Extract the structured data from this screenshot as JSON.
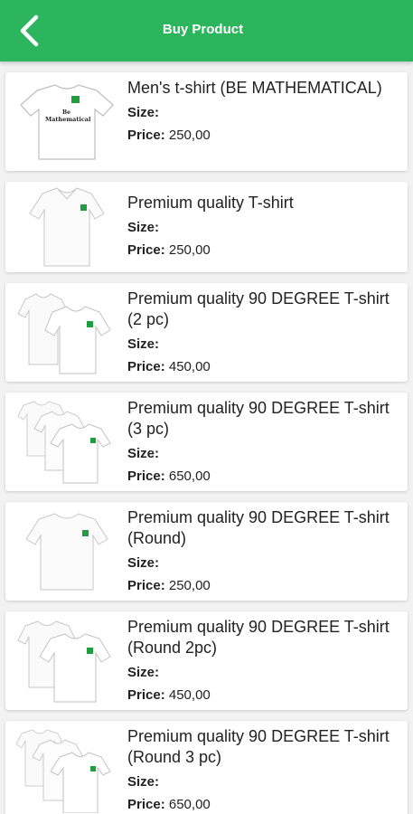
{
  "header": {
    "title": "Buy Product"
  },
  "labels": {
    "size": "Size:",
    "price": "Price:"
  },
  "products": [
    {
      "name": "Men's t-shirt (BE MATHEMATICAL)",
      "price": "250,00",
      "logo_text": "Be Mathematical"
    },
    {
      "name": "Premium quality T-shirt",
      "price": "250,00"
    },
    {
      "name": "Premium quality 90 DEGREE T-shirt (2 pc)",
      "price": "450,00"
    },
    {
      "name": "Premium quality 90 DEGREE T-shirt (3 pc)",
      "price": "650,00"
    },
    {
      "name": "Premium quality 90 DEGREE T-shirt (Round)",
      "price": "250,00"
    },
    {
      "name": "Premium quality 90 DEGREE T-shirt (Round 2pc)",
      "price": "450,00"
    },
    {
      "name": "Premium quality 90 DEGREE T-shirt (Round 3 pc)",
      "price": "650,00"
    }
  ],
  "colors": {
    "accent": "#2db55d",
    "badge": "#1e9e3e"
  }
}
